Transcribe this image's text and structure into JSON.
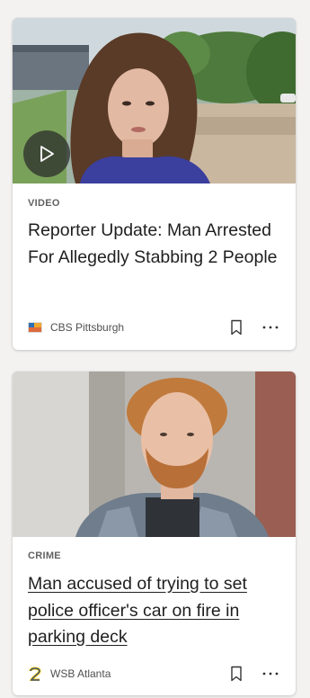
{
  "cards": [
    {
      "category": "VIDEO",
      "headline": "Reporter Update: Man Arrested For Allegedly Stabbing 2 People",
      "source": "CBS Pittsburgh",
      "has_play_button": true
    },
    {
      "category": "CRIME",
      "headline": "Man accused of trying to set police officer's car on fire in parking deck",
      "source": "WSB Atlanta",
      "has_play_button": false
    }
  ],
  "icons": {
    "play": "play-icon",
    "bookmark": "bookmark-icon",
    "more": "more-options-icon"
  },
  "colors": {
    "page_background": "#f3f2f1",
    "card_background": "#ffffff",
    "headline": "#1f1f1f",
    "category": "#616161"
  }
}
